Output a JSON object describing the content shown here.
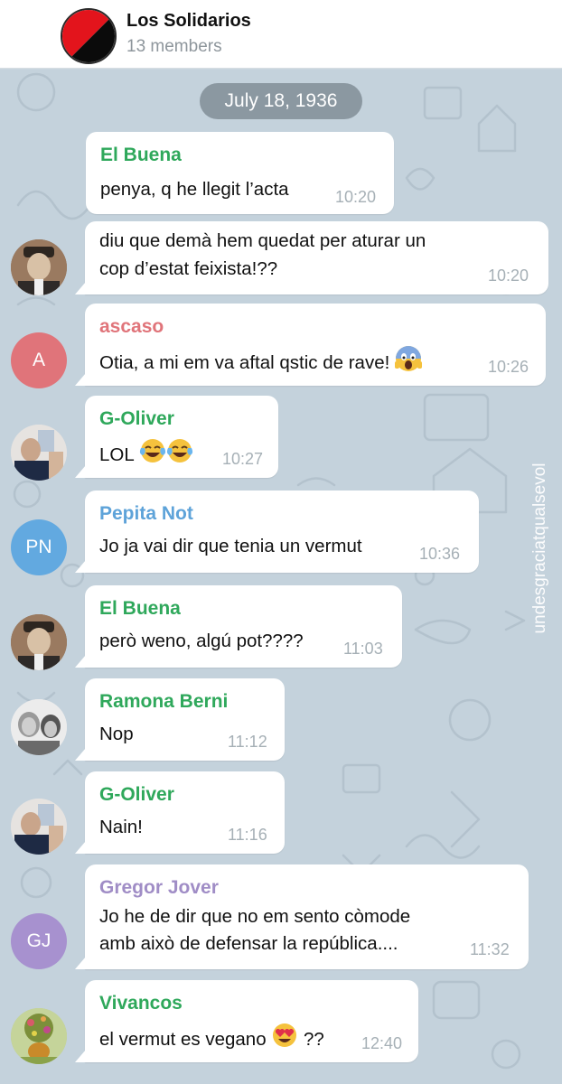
{
  "header": {
    "title": "Los Solidarios",
    "subtitle": "13 members"
  },
  "chat": {
    "date": "July 18, 1936",
    "watermark": "undesgraciatqualsevol",
    "messages": [
      {
        "sender": "El Buena",
        "lines": [
          "penya, q he llegit l’acta"
        ],
        "time": "10:20"
      },
      {
        "sender": "",
        "lines": [
          "diu que demà hem quedat per aturar un",
          "cop d’estat feixista!??"
        ],
        "time": "10:20"
      },
      {
        "sender": "ascaso",
        "lines": [
          "Otia, a mi em va aftal qstic de rave!"
        ],
        "time": "10:26"
      },
      {
        "sender": "G-Oliver",
        "lines": [
          "LOL"
        ],
        "time": "10:27"
      },
      {
        "sender": "Pepita Not",
        "lines": [
          "Jo ja vai dir que tenia un vermut"
        ],
        "time": "10:36"
      },
      {
        "sender": "El Buena",
        "lines": [
          "però weno, algú pot????"
        ],
        "time": "11:03"
      },
      {
        "sender": "Ramona Berni",
        "lines": [
          "Nop"
        ],
        "time": "11:12"
      },
      {
        "sender": "G-Oliver",
        "lines": [
          "Nain!"
        ],
        "time": "11:16"
      },
      {
        "sender": "Gregor Jover",
        "lines": [
          "Jo he de dir que no em sento còmode",
          "amb això de defensar la república...."
        ],
        "time": "11:32"
      },
      {
        "sender": "Vivancos",
        "lines": [
          "el vermut es vegano",
          "??"
        ],
        "time": "12:40"
      }
    ],
    "avatars": {
      "ascaso": "A",
      "pepita": "PN",
      "gregor": "GJ"
    }
  },
  "colors": {
    "green_name": "#2fa85b",
    "red_name": "#e0747a",
    "blue_name": "#5ea3d9",
    "purple_name": "#a08dc6",
    "avatar_red": "#e0747a",
    "avatar_blue": "#62a9e0",
    "avatar_purple": "#a791cf"
  },
  "icons": [
    "fearful-face-emoji",
    "tears-of-joy-emoji",
    "heart-eyes-emoji",
    "cnt-fai-flag"
  ]
}
